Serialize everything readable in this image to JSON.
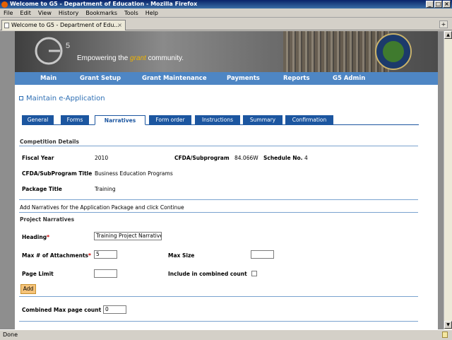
{
  "window": {
    "title": "Welcome to G5 - Department of Education - Mozilla Firefox"
  },
  "menu": [
    "File",
    "Edit",
    "View",
    "History",
    "Bookmarks",
    "Tools",
    "Help"
  ],
  "browser_tab": {
    "label": "Welcome to G5 - Department of Edu...",
    "new_tab": "+"
  },
  "banner": {
    "logo_text": "G",
    "logo_superscript": "5",
    "tagline_pre": "Empowering the ",
    "tagline_accent": "grant",
    "tagline_post": " community."
  },
  "nav": [
    "Main",
    "Grant Setup",
    "Grant Maintenance",
    "Payments",
    "Reports",
    "G5 Admin"
  ],
  "page_title": "Maintain e-Application",
  "tabs": [
    "General",
    "Forms",
    "Narratives",
    "Form order",
    "Instructions",
    "Summary",
    "Confirmation"
  ],
  "active_tab": "Narratives",
  "competition": {
    "section_title": "Competition Details",
    "fiscal_year_label": "Fiscal Year",
    "fiscal_year": "2010",
    "cfda_label": "CFDA/Subprogram",
    "cfda": "84.066W",
    "schedule_label": "Schedule No.",
    "schedule": "4",
    "cfda_title_label": "CFDA/SubProgram Title",
    "cfda_title": "Business Education Programs",
    "package_label": "Package Title",
    "package": "Training"
  },
  "instructions": "Add Narratives for the Application Package and click Continue",
  "narratives": {
    "section_title": "Project Narratives",
    "heading_label": "Heading",
    "heading_value": "Training Project Narrative",
    "max_attach_label": "Max # of Attachments",
    "max_attach_value": "5",
    "max_size_label": "Max Size",
    "max_size_value": "",
    "page_limit_label": "Page Limit",
    "page_limit_value": "",
    "include_label": "Include in combined count",
    "include_checked": false,
    "required_marker": "*",
    "add_label": "Add",
    "combined_label": "Combined Max page count",
    "combined_value": "0"
  },
  "status": "Done",
  "colors": {
    "nav": "#4e86c4",
    "tab": "#1c56a0",
    "title": "#2e6fb4",
    "button": "#f5c37a"
  }
}
